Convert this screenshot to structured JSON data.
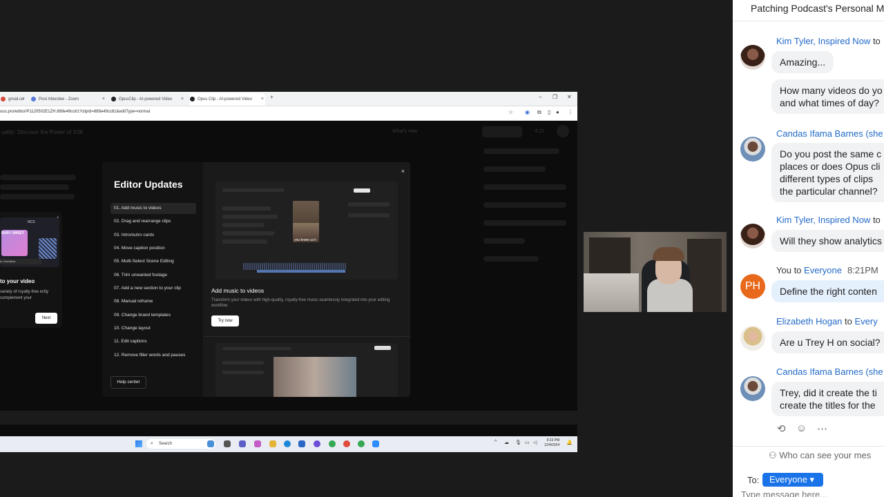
{
  "browser": {
    "tabs": [
      {
        "label": "gmail.co"
      },
      {
        "label": "Post Attendee - Zoom"
      },
      {
        "label": "OpusClip - AI-powered Video"
      },
      {
        "label": "Opus Clip - AI-powered Video"
      }
    ],
    "new_tab": "+",
    "url": "ous.pro/editor/P1120502E1ZH.889e49cc61?clipId=889e49cc61&editType=normal"
  },
  "left_card": {
    "brand": "NCS",
    "thumb_title": "BABY SWEET",
    "thumb_strip": "ic: Overdrive",
    "title": "to your video",
    "description": "variety of royalty-free ectly complement your",
    "next_label": "Next"
  },
  "modal": {
    "title": "Editor Updates",
    "items": [
      "01. Add music to videos",
      "02. Drag and rearrange clips",
      "03. Intro/outro cards",
      "04. Move caption position",
      "05. Multi-Select Scene Editing",
      "06. Trim unwanted footage",
      "07. Add a new section to your clip",
      "08. Manual reframe",
      "09. Change brand templates",
      "10. Change layout",
      "11. Edit captions",
      "12. Remove filler words and pauses"
    ],
    "help_label": "Help center",
    "feature_title": "Add music to videos",
    "feature_desc": "Transform your videos with high-quality, royalty-free music-seamlessly integrated into your editing workflow.",
    "try_label": "Try now",
    "preview_caption": "you know ca h"
  },
  "bg_text": {
    "header_title": "uality: Discover the Power of X38",
    "whats_new": "What's new",
    "credits": "6 27"
  },
  "taskbar": {
    "search_placeholder": "Search",
    "time": "9:23 PM",
    "date": "12/4/2024"
  },
  "chat": {
    "title": "Patching Podcast's Personal M",
    "messages": [
      {
        "sender": "Kim Tyler, Inspired Now",
        "to": "to",
        "text": [
          "Amazing..."
        ]
      },
      {
        "sender": "",
        "to": "",
        "text": [
          "How many videos do yo",
          "and what times of day?"
        ]
      },
      {
        "sender": "Candas Ifama Barnes (she",
        "to": "",
        "text": [
          "Do you post the same c",
          "places or does Opus cli",
          "different types of clips",
          "the particular channel?"
        ]
      },
      {
        "sender": "Kim Tyler, Inspired Now",
        "to": "to",
        "text": [
          "Will they show analytics"
        ]
      },
      {
        "sender": "You",
        "to": "to",
        "recipient": "Everyone",
        "time": "8:21PM",
        "avatar_initials": "PH",
        "text": [
          "Define the right conten"
        ]
      },
      {
        "sender": "Elizabeth Hogan",
        "to": "to",
        "recipient": "Every",
        "text": [
          "Are u Trey H on social?"
        ]
      },
      {
        "sender": "Candas Ifama Barnes (she",
        "to": "",
        "text": [
          "Trey, did it create the ti",
          "create the titles for the"
        ]
      }
    ],
    "who_can_see": "Who can see your mes",
    "to_label": "To:",
    "recipient_button": "Everyone",
    "input_placeholder": "Type message here..."
  },
  "colors": {
    "chat_link": "#2269c8",
    "recipient_button": "#1a73e8",
    "you_avatar": "#e8681c"
  }
}
